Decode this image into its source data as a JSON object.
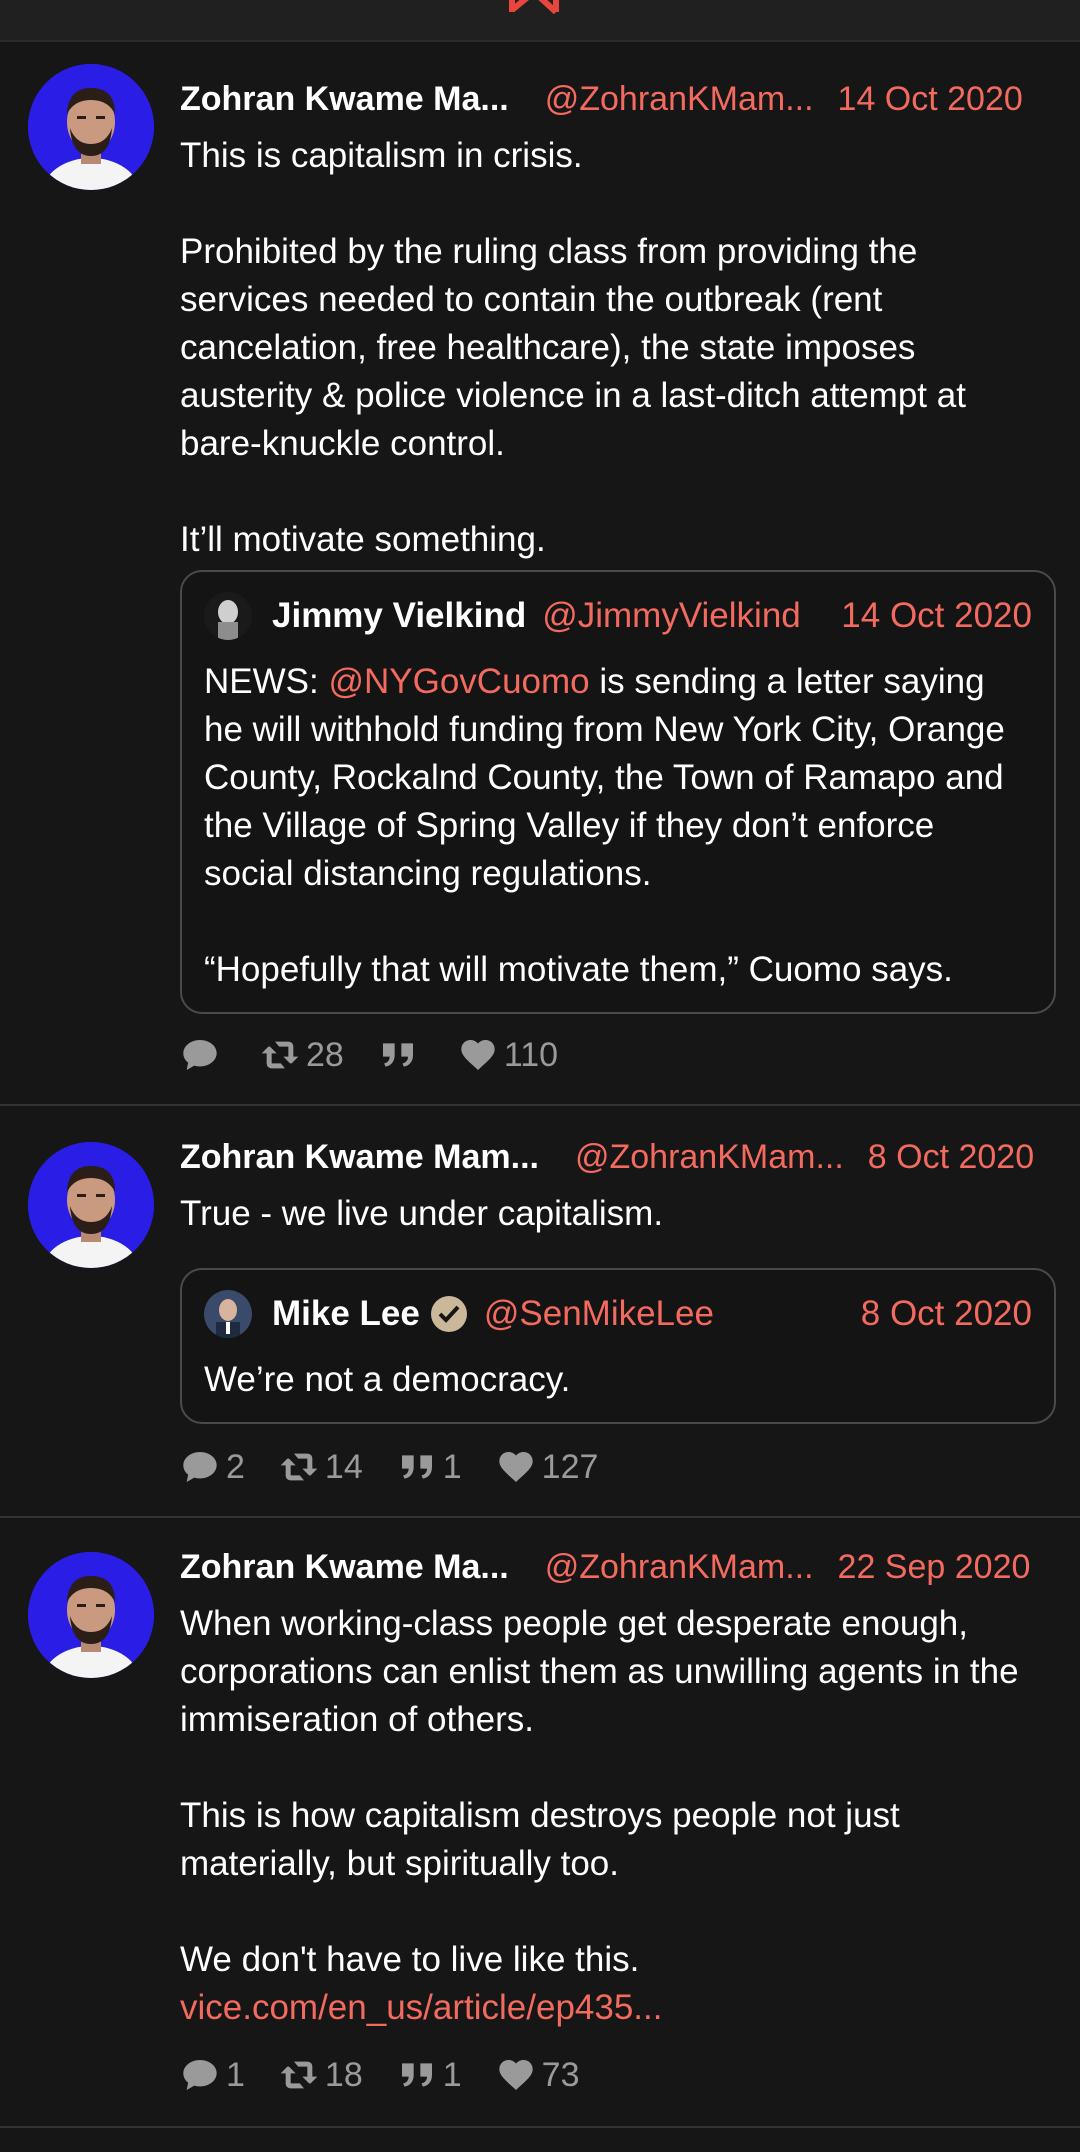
{
  "colors": {
    "background": "#161616",
    "accent": "#f36a5f",
    "text": "#ffffff",
    "muted": "#9a9a9a"
  },
  "tweets": [
    {
      "name": "Zohran Kwame Ma...",
      "handle": "@ZohranKMam...",
      "date": "14 Oct 2020",
      "text": "This is capitalism in crisis.\n\nProhibited by the ruling class from providing the services needed to contain the outbreak (rent cancelation, free healthcare), the state imposes austerity & police violence in a last-ditch attempt at bare-knuckle control.\n\nIt’ll motivate something.",
      "quote": {
        "name": "Jimmy Vielkind",
        "handle": "@JimmyVielkind",
        "date": "14 Oct 2020",
        "text_prefix": "NEWS: ",
        "mention": "@NYGovCuomo",
        "text_suffix": " is sending a letter saying he will withhold funding from New York City, Orange County, Rockalnd County, the Town of Ramapo and the Village of Spring Valley if they don’t enforce social distancing regulations.\n\n“Hopefully that will motivate them,” Cuomo says."
      },
      "replies": "",
      "retweets": "28",
      "quotes": "",
      "likes": "110"
    },
    {
      "name": "Zohran Kwame Mam...",
      "handle": "@ZohranKMam...",
      "date": "8 Oct 2020",
      "text": "True - we live under capitalism.",
      "quote": {
        "name": "Mike Lee",
        "handle": "@SenMikeLee",
        "date": "8 Oct 2020",
        "text": "We’re not a democracy."
      },
      "replies": "2",
      "retweets": "14",
      "quotes": "1",
      "likes": "127"
    },
    {
      "name": "Zohran Kwame Ma...",
      "handle": "@ZohranKMam...",
      "date": "22 Sep 2020",
      "text": "When working-class people get desperate enough, corporations can enlist them as unwilling agents in the immiseration of others.\n\nThis is how capitalism destroys people not just materially, but spiritually too.\n\nWe don't have to live like this.",
      "link": "vice.com/en_us/article/ep435...",
      "replies": "1",
      "retweets": "18",
      "quotes": "1",
      "likes": "73"
    }
  ]
}
